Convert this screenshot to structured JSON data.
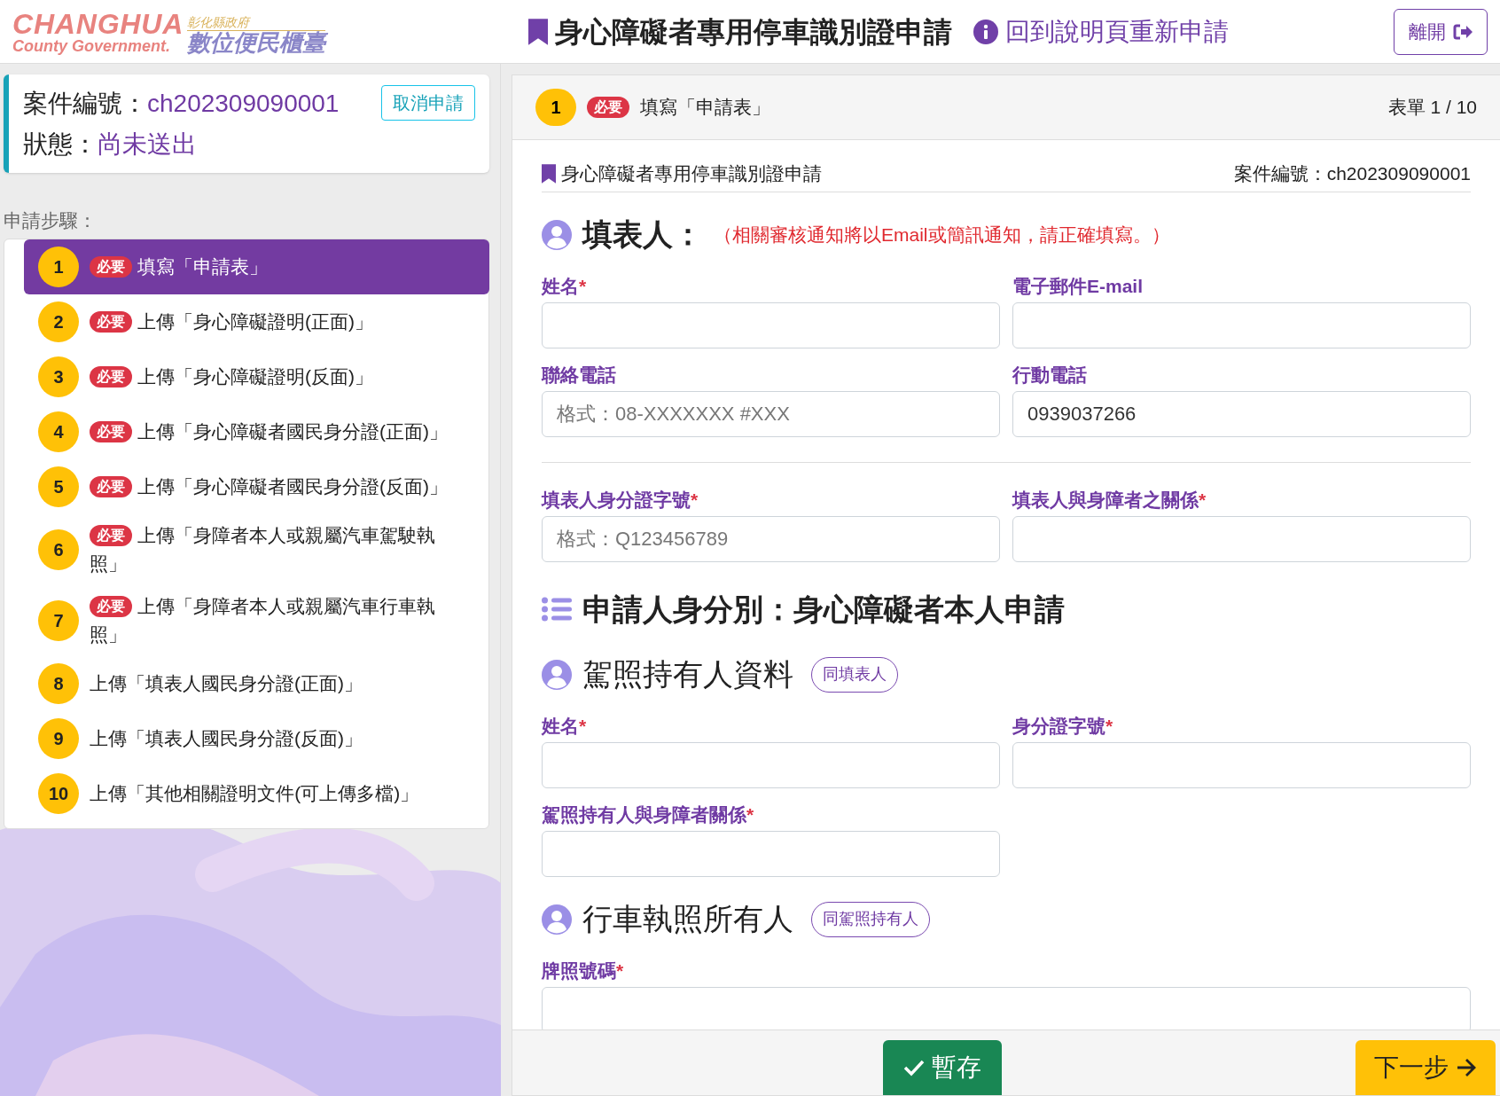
{
  "header": {
    "logo": {
      "english_top": "CHANGHUA",
      "english_bottom": "County Government.",
      "chinese_top": "彰化縣政府",
      "chinese_bottom": "數位便民櫃臺"
    },
    "title": "身心障礙者專用停車識別證申請",
    "restart_link": "回到說明頁重新申請",
    "exit_button": "離開"
  },
  "case_card": {
    "case_label": "案件編號：",
    "case_number": "ch202309090001",
    "status_label": "狀態：",
    "status": "尚未送出",
    "cancel_button": "取消申請"
  },
  "steps_label": "申請步驟：",
  "steps": [
    {
      "number": "1",
      "badge": "必要",
      "label": "填寫「申請表」",
      "selected": true
    },
    {
      "number": "2",
      "badge": "必要",
      "label": "上傳「身心障礙證明(正面)」",
      "selected": false
    },
    {
      "number": "3",
      "badge": "必要",
      "label": "上傳「身心障礙證明(反面)」",
      "selected": false
    },
    {
      "number": "4",
      "badge": "必要",
      "label": "上傳「身心障礙者國民身分證(正面)」",
      "selected": false
    },
    {
      "number": "5",
      "badge": "必要",
      "label": "上傳「身心障礙者國民身分證(反面)」",
      "selected": false
    },
    {
      "number": "6",
      "badge": "必要",
      "label": "上傳「身障者本人或親屬汽車駕駛執照」",
      "selected": false
    },
    {
      "number": "7",
      "badge": "必要",
      "label": "上傳「身障者本人或親屬汽車行車執照」",
      "selected": false
    },
    {
      "number": "8",
      "label": "上傳「填表人國民身分證(正面)」",
      "selected": false
    },
    {
      "number": "9",
      "label": "上傳「填表人國民身分證(反面)」",
      "selected": false
    },
    {
      "number": "10",
      "label": "上傳「其他相關證明文件(可上傳多檔)」",
      "selected": false
    }
  ],
  "form_bar": {
    "number": "1",
    "badge": "必要",
    "label": "填寫「申請表」",
    "page": "表單 1 / 10"
  },
  "document": {
    "title": "身心障礙者專用停車識別證申請",
    "case_number": "案件編號：ch202309090001"
  },
  "sections": [
    {
      "kind": "person",
      "title": "填表人：",
      "note": "（相關審核通知將以Email或簡訊通知，請正確填寫。）",
      "rows": [
        {
          "kind": "fields",
          "fields": [
            {
              "label": "姓名",
              "required_mark": "*"
            },
            {
              "label": "電子郵件E-mail"
            }
          ]
        },
        {
          "kind": "fields",
          "fields": [
            {
              "label": "聯絡電話",
              "placeholder": "格式：08-XXXXXXX #XXX"
            },
            {
              "label": "行動電話",
              "value": "0939037266"
            }
          ]
        },
        {
          "kind": "divider"
        },
        {
          "kind": "fields",
          "fields": [
            {
              "label": "填表人身分證字號",
              "required_mark": "*",
              "placeholder": "格式：Q123456789"
            },
            {
              "label": "填表人與身障者之關係",
              "required_mark": "*"
            }
          ]
        }
      ]
    },
    {
      "kind": "heading",
      "title": "申請人身分別：身心障礙者本人申請"
    },
    {
      "kind": "person",
      "title": "駕照持有人資料",
      "button": "同填表人",
      "rows": [
        {
          "kind": "fields",
          "fields": [
            {
              "label": "姓名",
              "required_mark": "*"
            },
            {
              "label": "身分證字號",
              "required_mark": "*"
            }
          ]
        },
        {
          "kind": "fields",
          "fields": [
            {
              "label": "駕照持有人與身障者關係",
              "required_mark": "*"
            }
          ]
        }
      ]
    },
    {
      "kind": "person",
      "title": "行車執照所有人",
      "button": "同駕照持有人",
      "rows": [
        {
          "kind": "fields",
          "fields": [
            {
              "label": "牌照號碼",
              "required_mark": "*",
              "wide": true
            }
          ]
        }
      ]
    }
  ],
  "footer": {
    "save_button": "暫存",
    "next_button": "下一步"
  }
}
